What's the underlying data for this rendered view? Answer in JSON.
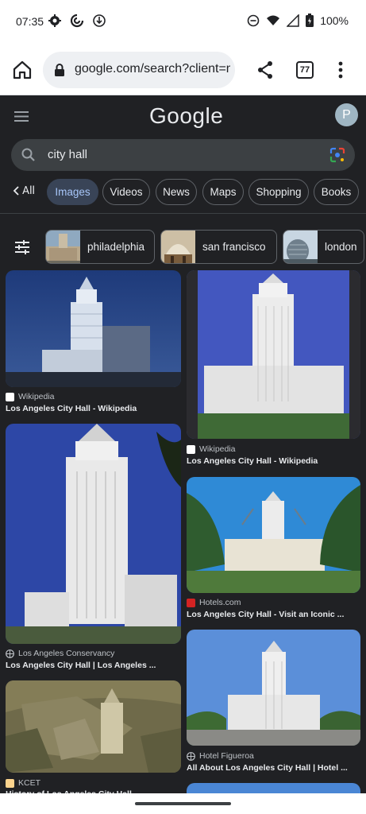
{
  "status": {
    "time": "07:35",
    "battery": "100%"
  },
  "browser": {
    "url": "google.com/search?client=ms",
    "tab_count": "77"
  },
  "google": {
    "logo": "Google",
    "avatar_letter": "P",
    "query": "city hall"
  },
  "tabs": {
    "all": "All",
    "items": [
      "Images",
      "Videos",
      "News",
      "Maps",
      "Shopping",
      "Books"
    ]
  },
  "filters": [
    "philadelphia",
    "san francisco",
    "london"
  ],
  "results": [
    {
      "source": "Wikipedia",
      "title": "Los Angeles City Hall - Wikipedia"
    },
    {
      "source": "Wikipedia",
      "title": "Los Angeles City Hall - Wikipedia"
    },
    {
      "source": "Los Angeles Conservancy",
      "title": "Los Angeles City Hall | Los Angeles ..."
    },
    {
      "source": "Hotels.com",
      "title": "Los Angeles City Hall - Visit an Iconic ..."
    },
    {
      "source": "KCET",
      "title": "History of Los Angeles City Hall ..."
    },
    {
      "source": "Hotel Figueroa",
      "title": "All About Los Angeles City Hall | Hotel ..."
    }
  ],
  "colors": {
    "background": "#202124",
    "active_chip": "#394457",
    "active_chip_text": "#a8c7fa"
  }
}
